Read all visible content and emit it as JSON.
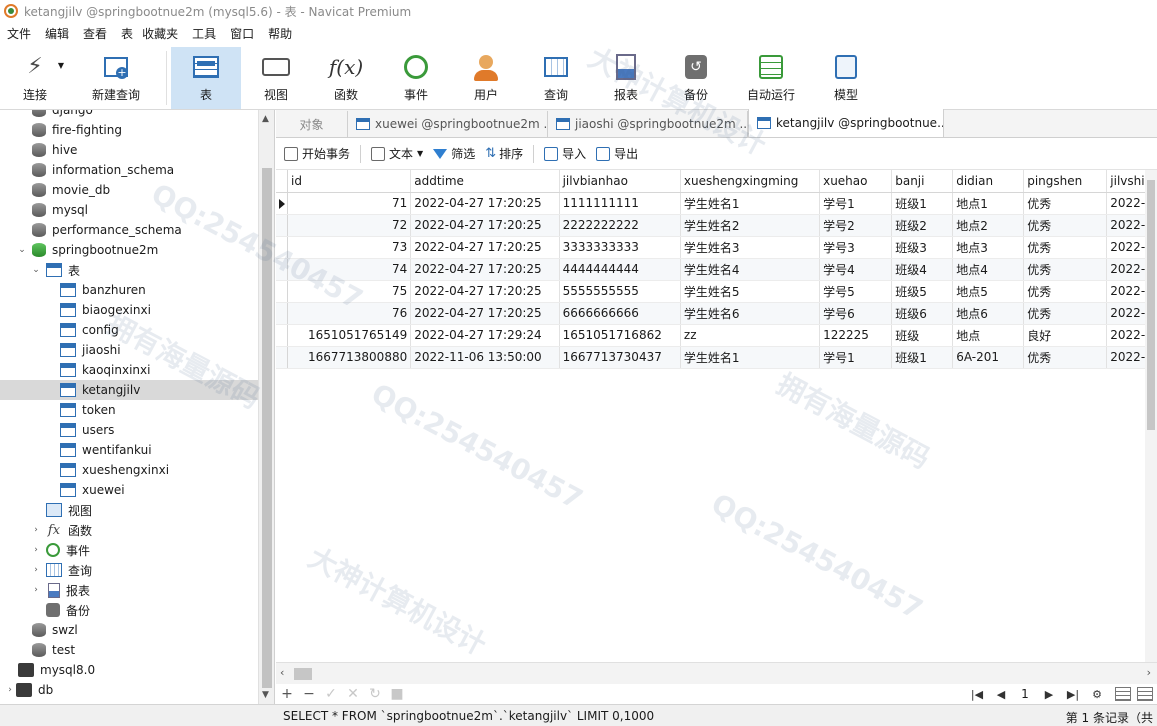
{
  "window": {
    "title": "ketangjilv @springbootnue2m (mysql5.6) - 表 - Navicat Premium"
  },
  "menu": [
    "文件",
    "编辑",
    "查看",
    "表",
    "收藏夹",
    "工具",
    "窗口",
    "帮助"
  ],
  "toolbar": [
    {
      "label": "连接",
      "icon": "plug-icon"
    },
    {
      "label": "新建查询",
      "icon": "new-query-icon"
    },
    {
      "label": "表",
      "icon": "table-icon",
      "active": true
    },
    {
      "label": "视图",
      "icon": "view-icon"
    },
    {
      "label": "函数",
      "icon": "function-icon"
    },
    {
      "label": "事件",
      "icon": "clock-icon"
    },
    {
      "label": "用户",
      "icon": "user-icon"
    },
    {
      "label": "查询",
      "icon": "query-icon"
    },
    {
      "label": "报表",
      "icon": "report-icon"
    },
    {
      "label": "备份",
      "icon": "backup-icon"
    },
    {
      "label": "自动运行",
      "icon": "schedule-icon"
    },
    {
      "label": "模型",
      "icon": "model-icon"
    }
  ],
  "tree": {
    "top_dbs": [
      "django",
      "fire-fighting",
      "hive",
      "information_schema",
      "movie_db",
      "mysql",
      "performance_schema"
    ],
    "current_db": "springbootnue2m",
    "tables_label": "表",
    "tables": [
      "banzhuren",
      "biaogexinxi",
      "config",
      "jiaoshi",
      "kaoqinxinxi",
      "ketangjilv",
      "token",
      "users",
      "wentifankui",
      "xueshengxinxi",
      "xuewei"
    ],
    "selected_table": "ketangjilv",
    "groups": [
      "视图",
      "函数",
      "事件",
      "查询",
      "报表",
      "备份"
    ],
    "bottom_dbs": [
      "swzl",
      "test"
    ],
    "connections": [
      "mysql8.0",
      "db"
    ]
  },
  "tabs": {
    "objects": "对象",
    "items": [
      "xuewei @springbootnue2m ...",
      "jiaoshi @springbootnue2m ...",
      "ketangjilv @springbootnue..."
    ]
  },
  "actions": {
    "begin_transaction": "开始事务",
    "text": "文本",
    "filter": "筛选",
    "sort": "排序",
    "import": "导入",
    "export": "导出"
  },
  "table": {
    "columns": [
      "id",
      "addtime",
      "jilvbianhao",
      "xueshengxingming",
      "xuehao",
      "banji",
      "didian",
      "pingshen",
      "jilvshi"
    ],
    "rows": [
      [
        "71",
        "2022-04-27 17:20:25",
        "1111111111",
        "学生姓名1",
        "学号1",
        "班级1",
        "地点1",
        "优秀",
        "2022-"
      ],
      [
        "72",
        "2022-04-27 17:20:25",
        "2222222222",
        "学生姓名2",
        "学号2",
        "班级2",
        "地点2",
        "优秀",
        "2022-"
      ],
      [
        "73",
        "2022-04-27 17:20:25",
        "3333333333",
        "学生姓名3",
        "学号3",
        "班级3",
        "地点3",
        "优秀",
        "2022-"
      ],
      [
        "74",
        "2022-04-27 17:20:25",
        "4444444444",
        "学生姓名4",
        "学号4",
        "班级4",
        "地点4",
        "优秀",
        "2022-"
      ],
      [
        "75",
        "2022-04-27 17:20:25",
        "5555555555",
        "学生姓名5",
        "学号5",
        "班级5",
        "地点5",
        "优秀",
        "2022-"
      ],
      [
        "76",
        "2022-04-27 17:20:25",
        "6666666666",
        "学生姓名6",
        "学号6",
        "班级6",
        "地点6",
        "优秀",
        "2022-"
      ],
      [
        "1651051765149",
        "2022-04-27 17:29:24",
        "1651051716862",
        "zz",
        "122225",
        "班级",
        "地点",
        "良好",
        "2022-"
      ],
      [
        "1667713800880",
        "2022-11-06 13:50:00",
        "1667713730437",
        "学生姓名1",
        "学号1",
        "班级1",
        "6A-201",
        "优秀",
        "2022-"
      ]
    ]
  },
  "pager": {
    "page": "1"
  },
  "status": {
    "sql": "SELECT * FROM `springbootnue2m`.`ketangjilv` LIMIT 0,1000",
    "records": "第 1 条记录（共"
  },
  "watermarks": [
    "QQ:254540457",
    "大神计算机设计",
    "拥有海量源码"
  ]
}
